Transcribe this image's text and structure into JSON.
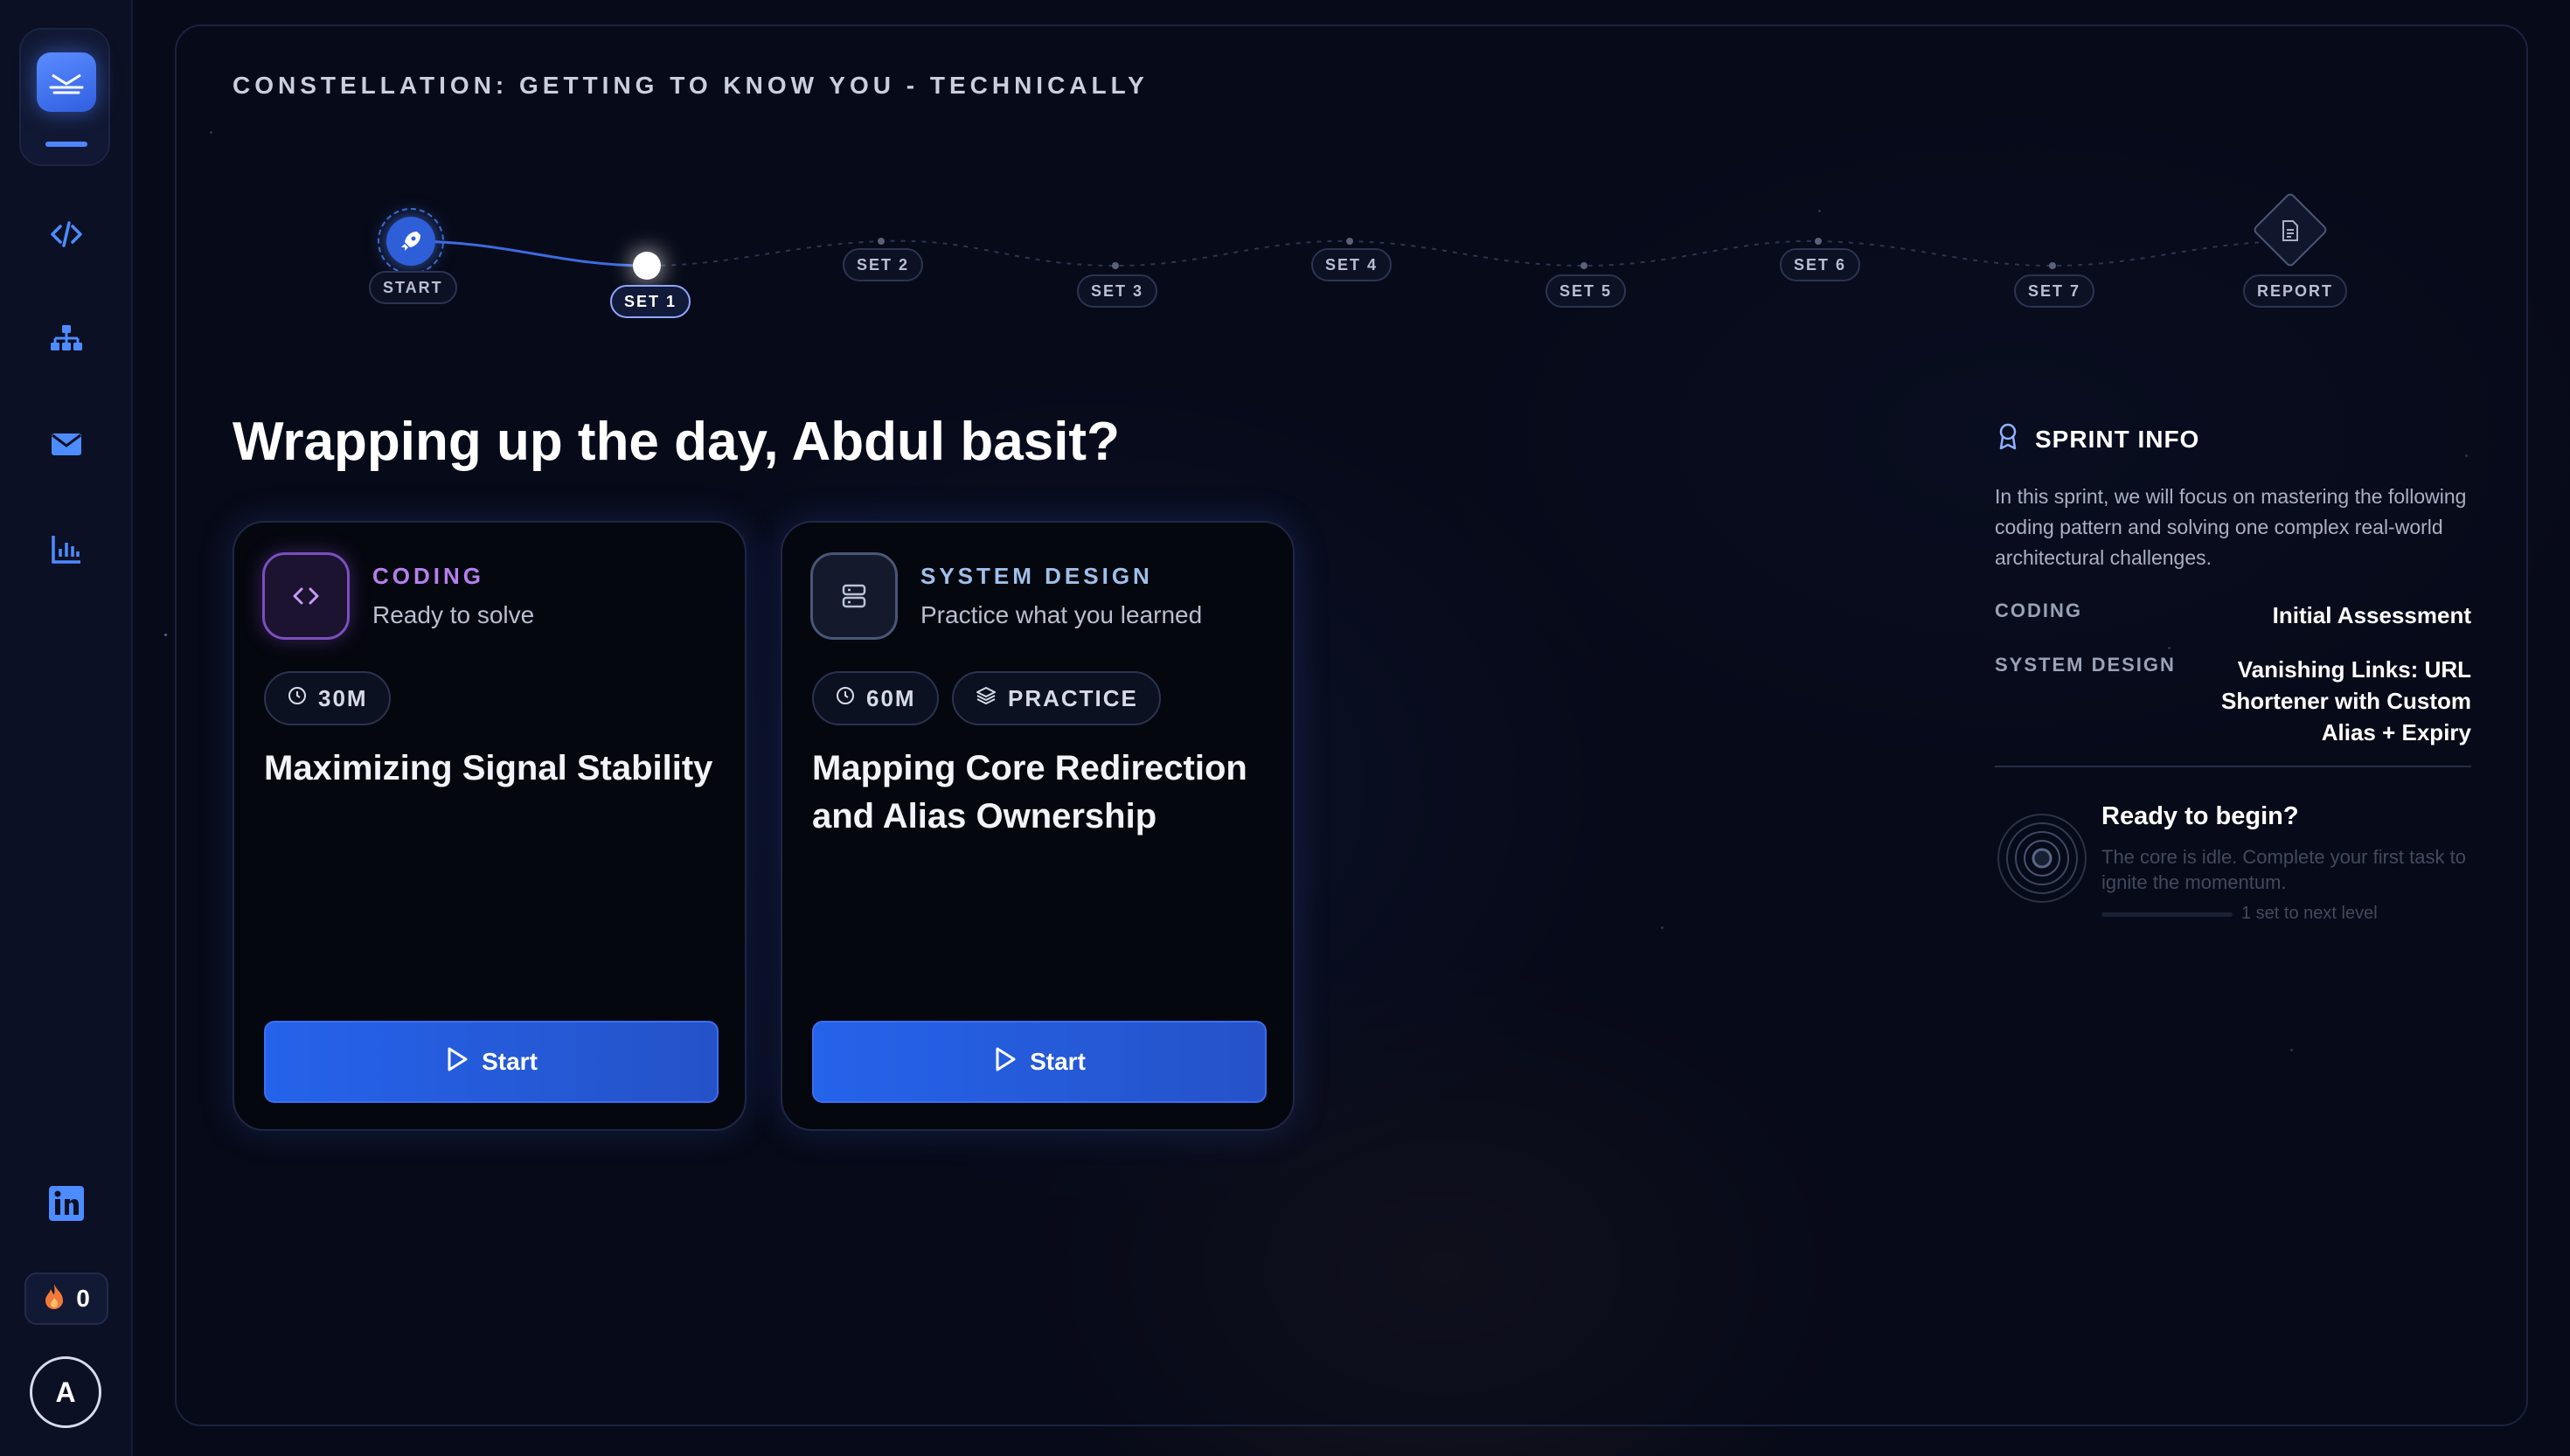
{
  "sidebar": {
    "logo_icon": "sunrise-icon",
    "nav": [
      {
        "name": "code-icon"
      },
      {
        "name": "sitemap-icon"
      },
      {
        "name": "mail-icon"
      },
      {
        "name": "analytics-icon"
      }
    ],
    "linkedin_icon": "linkedin-icon",
    "streak_count": "0",
    "avatar_initial": "A"
  },
  "constellation": {
    "title": "CONSTELLATION: GETTING TO KNOW YOU - TECHNICALLY",
    "nodes": [
      "START",
      "SET 1",
      "SET 2",
      "SET 3",
      "SET 4",
      "SET 5",
      "SET 6",
      "SET 7",
      "REPORT"
    ],
    "active": "SET 1"
  },
  "greeting": "Wrapping up the day, Abdul basit?",
  "cards": [
    {
      "category": "CODING",
      "subtitle": "Ready to solve",
      "duration": "30M",
      "title": "Maximizing Signal Stability",
      "button": "Start"
    },
    {
      "category": "SYSTEM DESIGN",
      "subtitle": "Practice what you learned",
      "duration": "60M",
      "mode": "PRACTICE",
      "title": "Mapping Core Redirection and Alias Ownership",
      "button": "Start"
    }
  ],
  "sprint": {
    "heading": "SPRINT INFO",
    "description": "In this sprint, we will focus on mastering the following coding pattern and solving one complex real-world architectural challenges.",
    "rows": [
      {
        "key": "CODING",
        "value": "Initial Assessment"
      },
      {
        "key": "SYSTEM DESIGN",
        "value": "Vanishing Links: URL Shortener with Custom Alias + Expiry"
      }
    ],
    "ready_title": "Ready to begin?",
    "ready_text": "The core is idle. Complete your first task to ignite the momentum.",
    "ready_next": "1 set to next level"
  },
  "colors": {
    "accent": "#2563eb",
    "coding": "#b77ff0",
    "design": "#9fc0ea"
  }
}
